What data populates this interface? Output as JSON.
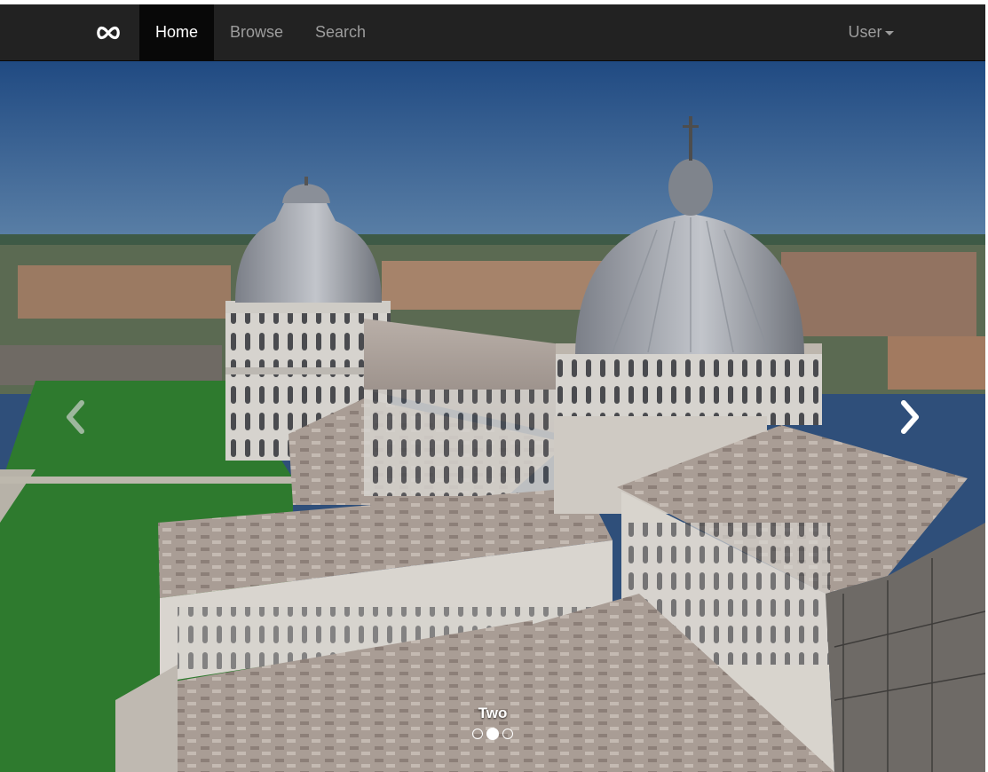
{
  "navbar": {
    "brand_icon": "infinity-icon",
    "items": [
      {
        "label": "Home",
        "active": true
      },
      {
        "label": "Browse",
        "active": false
      },
      {
        "label": "Search",
        "active": false
      }
    ],
    "user_menu": {
      "label": "User",
      "icon": "caret-down-icon"
    }
  },
  "carousel": {
    "caption": "Two",
    "slide_count": 3,
    "active_index": 1,
    "controls": {
      "prev_icon": "chevron-left-icon",
      "next_icon": "chevron-right-icon"
    }
  },
  "colors": {
    "navbar_bg": "#222222",
    "nav_active_bg": "#080808",
    "nav_text": "#9d9d9d",
    "nav_active_text": "#ffffff"
  }
}
